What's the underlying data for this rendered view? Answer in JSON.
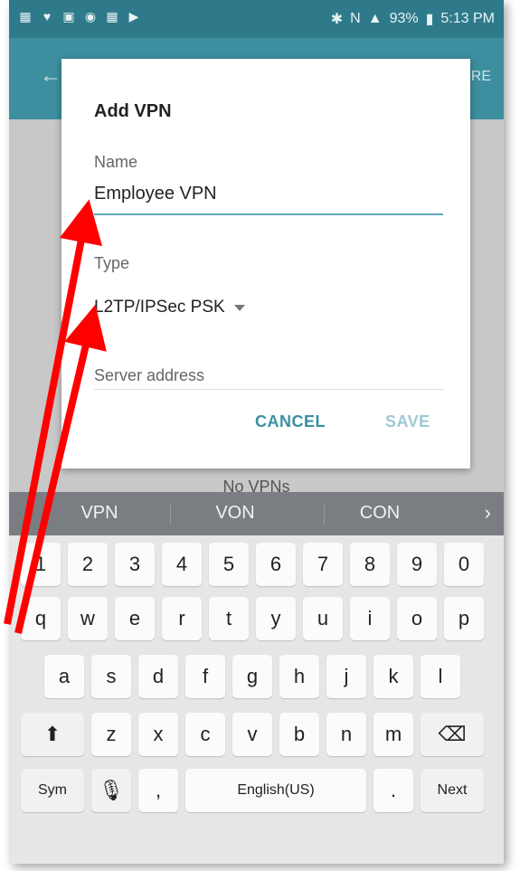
{
  "status_bar": {
    "left_icons": [
      "calendar-icon",
      "twitter-icon",
      "gallery-icon",
      "wifi-icon",
      "calendar-icon",
      "play-icon"
    ],
    "bluetooth": "✱",
    "nfc": "N",
    "battery": "93%",
    "time": "5:13 PM"
  },
  "app_bar": {
    "more_label": "RE"
  },
  "content": {
    "empty_text": "No VPNs"
  },
  "dialog": {
    "title": "Add VPN",
    "name_label": "Name",
    "name_value": "Employee VPN",
    "type_label": "Type",
    "type_value": "L2TP/IPSec PSK",
    "server_label": "Server address",
    "cancel_label": "CANCEL",
    "save_label": "SAVE"
  },
  "keyboard": {
    "suggestions": [
      "VPN",
      "VON",
      "CON"
    ],
    "numbers": [
      "1",
      "2",
      "3",
      "4",
      "5",
      "6",
      "7",
      "8",
      "9",
      "0"
    ],
    "row1": [
      "q",
      "w",
      "e",
      "r",
      "t",
      "y",
      "u",
      "i",
      "o",
      "p"
    ],
    "row2": [
      "a",
      "s",
      "d",
      "f",
      "g",
      "h",
      "j",
      "k",
      "l"
    ],
    "row3": [
      "z",
      "x",
      "c",
      "v",
      "b",
      "n",
      "m"
    ],
    "sym": "Sym",
    "comma": ",",
    "space": "English(US)",
    "period": ".",
    "next": "Next"
  },
  "colors": {
    "status_bar": "#2e7a8a",
    "app_bar": "#3d8f9f",
    "accent": "#3a8fa3",
    "annotation_arrow": "#ff0000"
  }
}
